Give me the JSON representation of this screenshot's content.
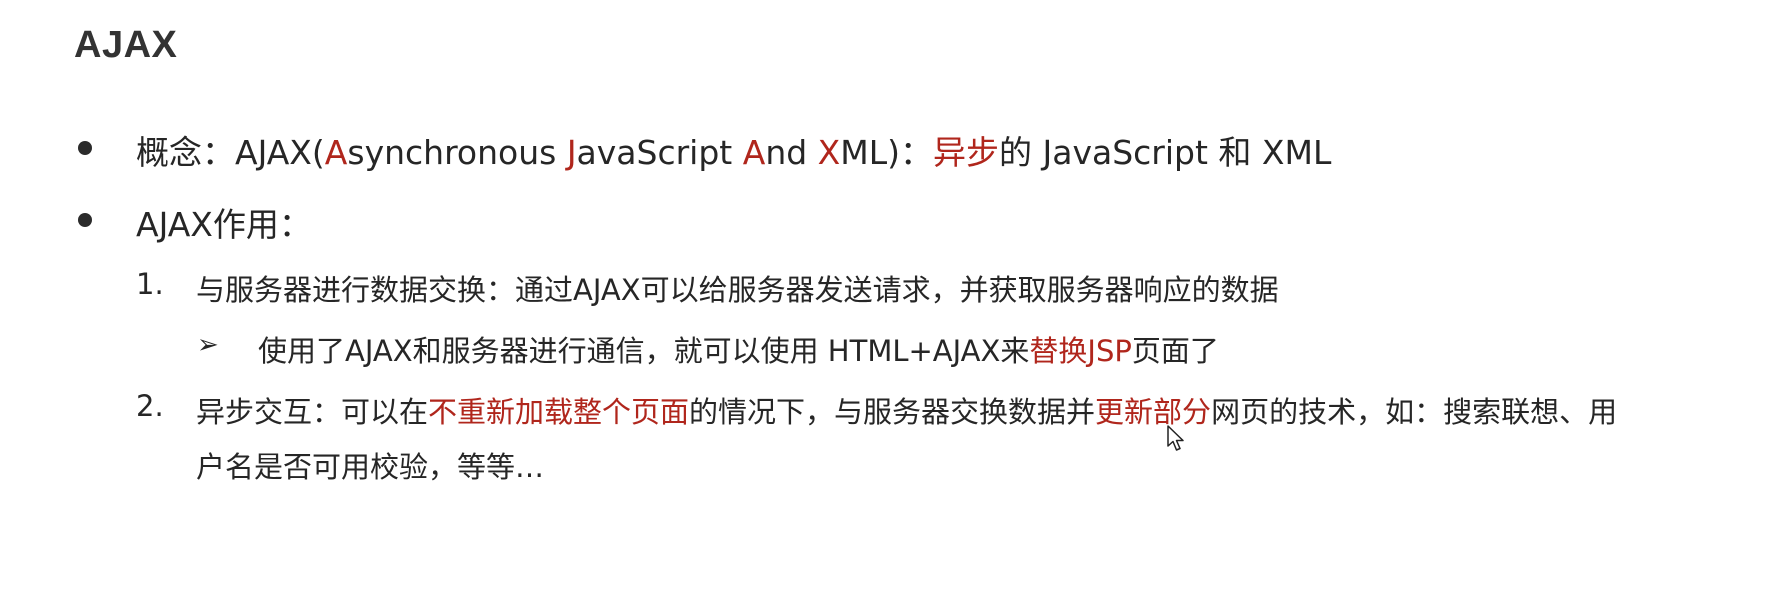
{
  "slide": {
    "title": "AJAX",
    "concept": {
      "prefix": "概念：AJAX(",
      "a1": "A",
      "synchronous": "synchronous ",
      "j": "J",
      "avascript": "avaScript ",
      "a2": "A",
      "nd": "nd ",
      "x": "X",
      "ml": "ML)：",
      "async": "异步",
      "suffix": "的 JavaScript 和 XML"
    },
    "role_heading": "AJAX作用：",
    "item1": {
      "number": "1.",
      "text": "与服务器进行数据交换：通过AJAX可以给服务器发送请求，并获取服务器响应的数据"
    },
    "sub1": {
      "arrow": "➢",
      "prefix": "使用了AJAX和服务器进行通信，就可以使用 HTML+AJAX来",
      "highlight": "替换JSP",
      "suffix": "页面了"
    },
    "item2": {
      "number": "2.",
      "part1": "异步交互：可以在",
      "highlight1": "不重新加载整个页面",
      "part2": "的情况下，与服务器交换数据并",
      "highlight2": "更新部分",
      "part3": "网页的技术，如：搜索联想、用",
      "line2": "户名是否可用校验，等等…"
    }
  },
  "colors": {
    "accent_red": "#b0261c",
    "text": "#262626"
  },
  "icons": {
    "bullet": "bullet-dot-icon",
    "sub_bullet": "arrow-bullet-icon",
    "cursor": "mouse-pointer-icon"
  }
}
